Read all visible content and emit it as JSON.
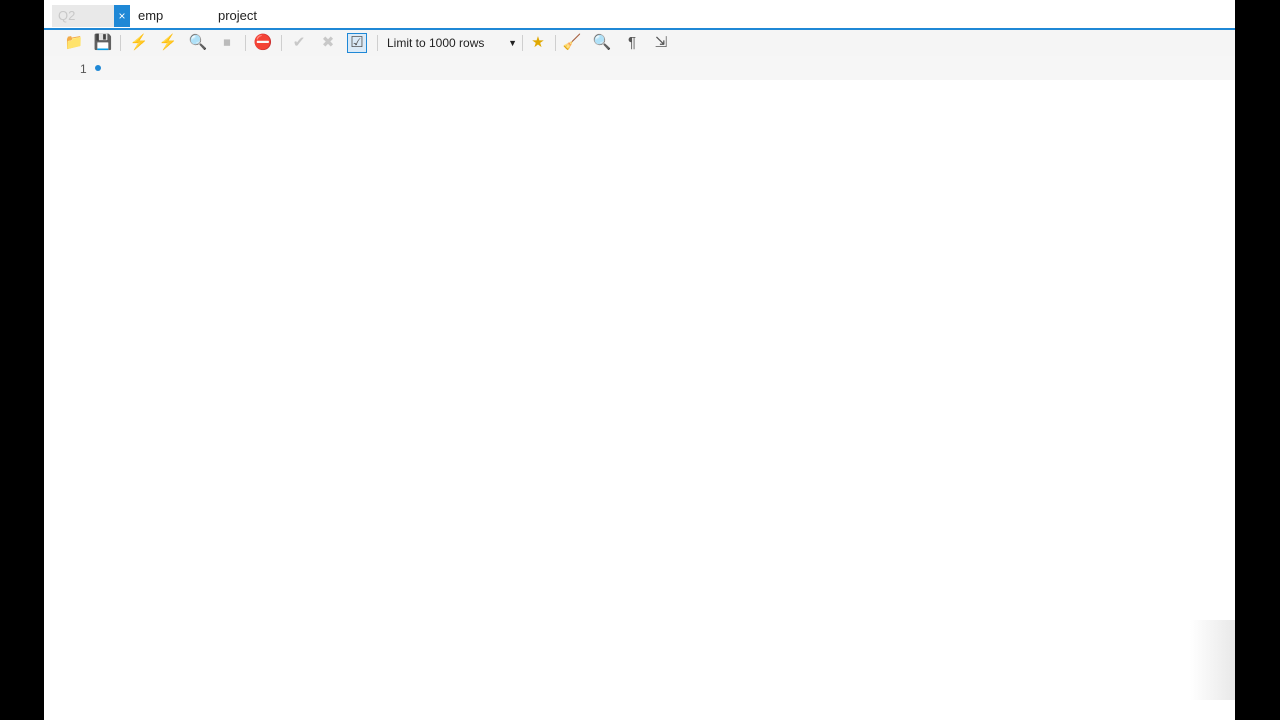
{
  "tabs": [
    {
      "label": "Q2"
    },
    {
      "label": "emp"
    },
    {
      "label": "project"
    }
  ],
  "tab_close_symbol": "×",
  "toolbar": {
    "icons": {
      "open": "📁",
      "save": "💾",
      "execute_all": "⚡",
      "execute_current": "⚡",
      "explain": "🔍",
      "stop": "⏹",
      "toggle_error": "⛔",
      "commit": "✔",
      "rollback": "✖",
      "autocommit": "☑",
      "favorite": "★",
      "beautify": "🧹",
      "find": "🔍",
      "invisible_chars": "¶",
      "wrap": "⇲"
    },
    "limit_label": "Limit to 1000 rows",
    "limit_caret": "▼"
  },
  "editor": {
    "line_number": "1"
  },
  "colors": {
    "accent": "#1f88d6",
    "background": "#ffffff",
    "outer": "#000000"
  }
}
